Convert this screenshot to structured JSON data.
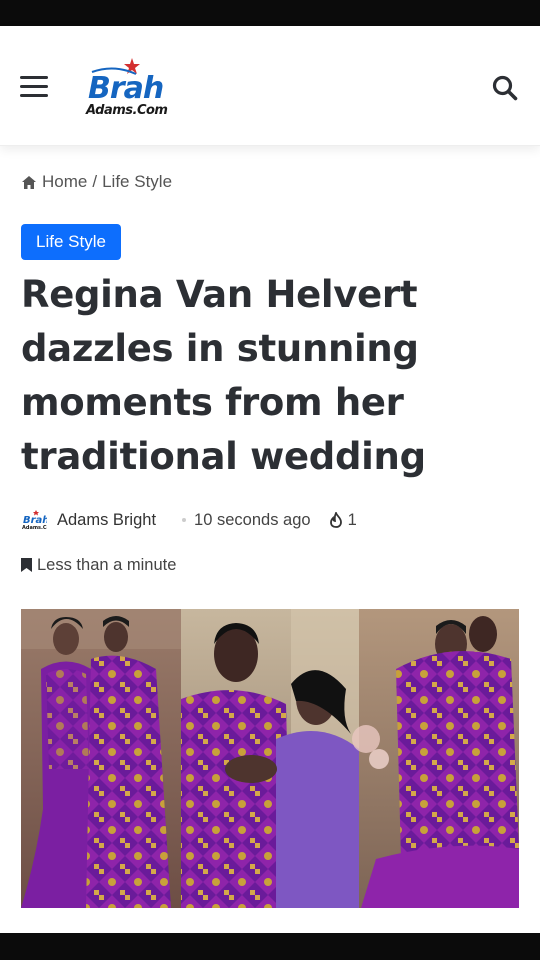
{
  "header": {
    "menu_icon": "hamburger-menu-icon",
    "logo_text_top": "Brah",
    "logo_text_bottom": "Adams.Com",
    "search_icon": "search-icon"
  },
  "breadcrumb": {
    "home": "Home",
    "separator": "/",
    "category": "Life Style"
  },
  "article": {
    "category_badge": "Life Style",
    "title": "Regina Van Helvert dazzles in stunning moments from her traditional wedding",
    "author": "Adams Bright",
    "time": "10 seconds ago",
    "views": "1",
    "reading_time": "Less than a minute"
  },
  "colors": {
    "accent": "#0d6efd",
    "text": "#2c2f34",
    "kente_purple": "#6a1b9a",
    "kente_gold": "#c8a13a"
  }
}
